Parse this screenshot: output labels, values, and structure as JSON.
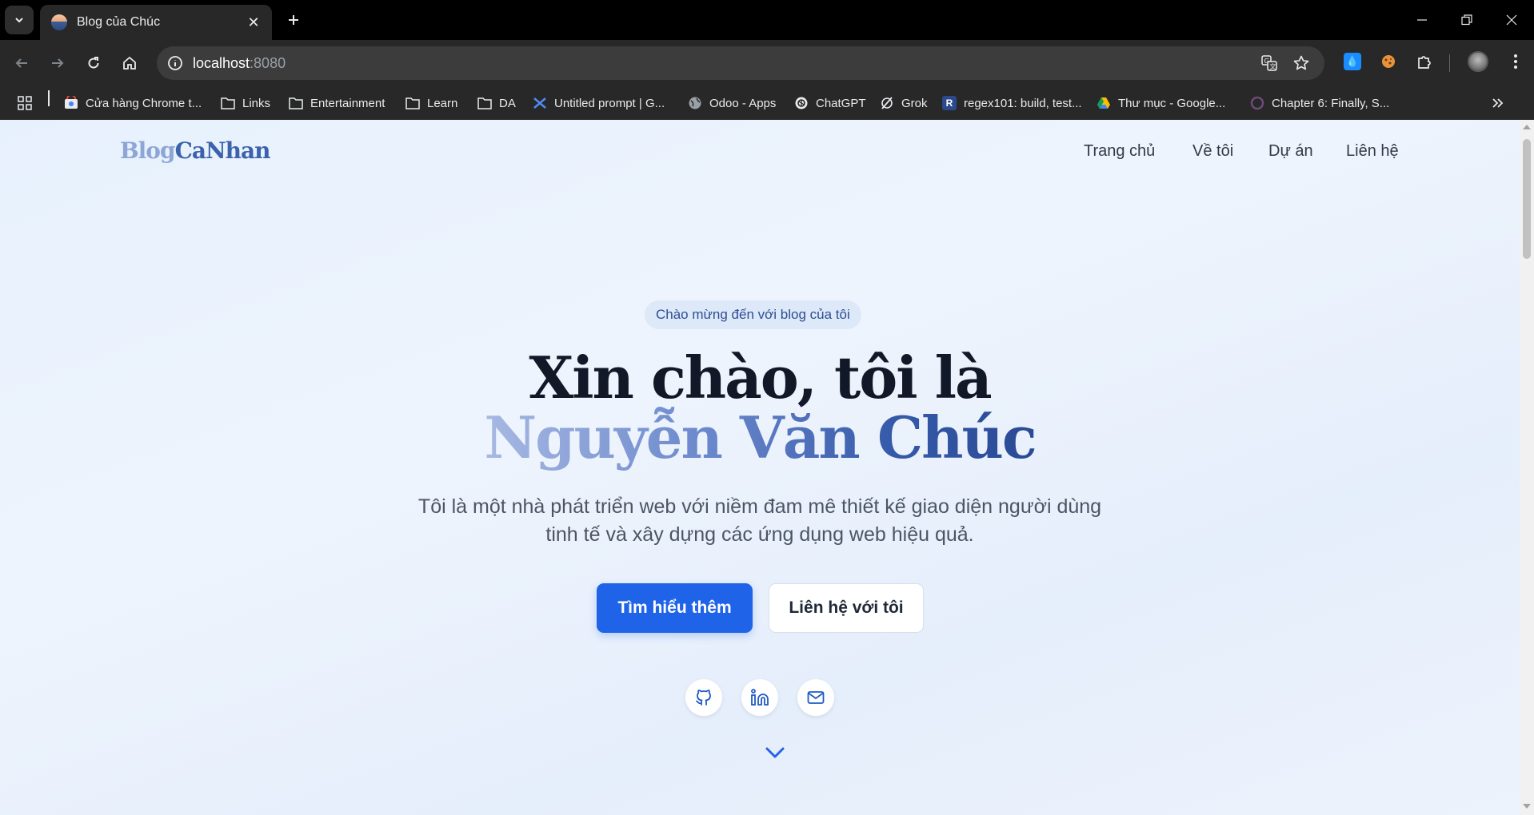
{
  "browser": {
    "tab": {
      "title": "Blog của Chúc"
    },
    "address_bar": {
      "host": "localhost",
      "port": ":8080"
    },
    "bookmarks": [
      {
        "label": "Cửa hàng Chrome t...",
        "icon": "chrome-webstore-icon"
      },
      {
        "label": "Links",
        "icon": "folder-icon"
      },
      {
        "label": "Entertainment",
        "icon": "folder-icon"
      },
      {
        "label": "Learn",
        "icon": "folder-icon"
      },
      {
        "label": "DA",
        "icon": "folder-icon"
      },
      {
        "label": "Untitled prompt | G...",
        "icon": "ai-studio-icon"
      },
      {
        "label": "Odoo - Apps",
        "icon": "globe-icon"
      },
      {
        "label": "ChatGPT",
        "icon": "chatgpt-icon"
      },
      {
        "label": "Grok",
        "icon": "grok-icon"
      },
      {
        "label": "regex101: build, test...",
        "icon": "regex101-icon"
      },
      {
        "label": "Thư mục - Google...",
        "icon": "google-drive-icon"
      },
      {
        "label": "Chapter 6: Finally, S...",
        "icon": "circle-icon"
      }
    ]
  },
  "site": {
    "logo_part1": "Blog",
    "logo_part2": "CaNhan",
    "nav": [
      "Trang chủ",
      "Về tôi",
      "Dự án",
      "Liên hệ"
    ],
    "hero": {
      "pill": "Chào mừng đến với blog của tôi",
      "title_line1": "Xin chào, tôi là",
      "title_line2": "Nguyễn Văn Chúc",
      "description": "Tôi là một nhà phát triển web với niềm đam mê thiết kế giao diện người dùng tinh tế và xây dựng các ứng dụng web hiệu quả.",
      "primary_button": "Tìm hiểu thêm",
      "secondary_button": "Liên hệ với tôi"
    },
    "social": [
      "github-icon",
      "linkedin-icon",
      "mail-icon"
    ]
  },
  "colors": {
    "accent": "#1f63e8",
    "brand_dark": "#3c62ad",
    "brand_light": "#8ea6d6"
  }
}
